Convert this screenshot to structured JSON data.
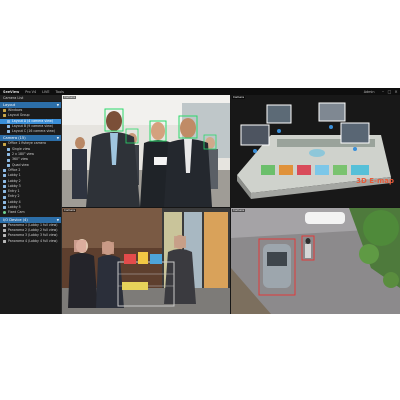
{
  "app": {
    "logo": "SeeView",
    "version": "Pro V4",
    "menu": [
      "LIVE",
      "Tools"
    ],
    "user": "Admin"
  },
  "sidebar": {
    "title": "Camera List",
    "layout_section": "Layout",
    "layout_items": [
      {
        "label": "Windows",
        "level": 1,
        "icon": "folder"
      },
      {
        "label": "Layout Group",
        "level": 1,
        "icon": "folder"
      },
      {
        "label": "Layout A (4 camera view)",
        "level": 2,
        "icon": "layout",
        "selected": true
      },
      {
        "label": "Layout B (9 camera view)",
        "level": 2,
        "icon": "layout"
      },
      {
        "label": "Layout C (16 camera view)",
        "level": 2,
        "icon": "layout"
      }
    ],
    "camera_section": "Camera (15)",
    "camera_items": [
      {
        "label": "Office 1 fisheye camera",
        "level": 1,
        "icon": "folder"
      },
      {
        "label": "Single view",
        "level": 2,
        "icon": "cam"
      },
      {
        "label": "2 x 180° view",
        "level": 2,
        "icon": "cam"
      },
      {
        "label": "360° view",
        "level": 2,
        "icon": "cam"
      },
      {
        "label": "Quad view",
        "level": 2,
        "icon": "cam"
      },
      {
        "label": "Office 2",
        "level": 1,
        "icon": "cam"
      },
      {
        "label": "Lobby 1",
        "level": 1,
        "icon": "cam"
      },
      {
        "label": "Lobby 2",
        "level": 1,
        "icon": "cam"
      },
      {
        "label": "Lobby 3",
        "level": 1,
        "icon": "cam"
      },
      {
        "label": "Entry 1",
        "level": 1,
        "icon": "cam"
      },
      {
        "label": "Entry 2",
        "level": 1,
        "icon": "cam"
      },
      {
        "label": "Lobby 4",
        "level": 1,
        "icon": "cam"
      },
      {
        "label": "Lobby 5",
        "level": 1,
        "icon": "cam"
      },
      {
        "label": "Fixed Cam",
        "level": 1,
        "icon": "ptz"
      }
    ],
    "device_section": "I/O Device (4)",
    "device_items": [
      {
        "label": "Panorama 1 (Lobby 1 full view)",
        "level": 1,
        "icon": "dev"
      },
      {
        "label": "Panorama 2 (Lobby 2 full view)",
        "level": 1,
        "icon": "dev"
      },
      {
        "label": "Panorama 3 (Lobby 3 full view)",
        "level": 1,
        "icon": "dev"
      },
      {
        "label": "Panorama 4 (Lobby 4 full view)",
        "level": 1,
        "icon": "dev"
      }
    ]
  },
  "views": {
    "v1": "Camera",
    "v2": "Camera",
    "v3": "Camera",
    "v4": "Camera",
    "emap_label": "3D E-map"
  },
  "colors": {
    "accent": "#2c6ea8",
    "selected": "#3a8fd9",
    "detect_green": "#2bd96b",
    "detect_red": "#e23a3a",
    "emap_text": "#e85b3a"
  }
}
